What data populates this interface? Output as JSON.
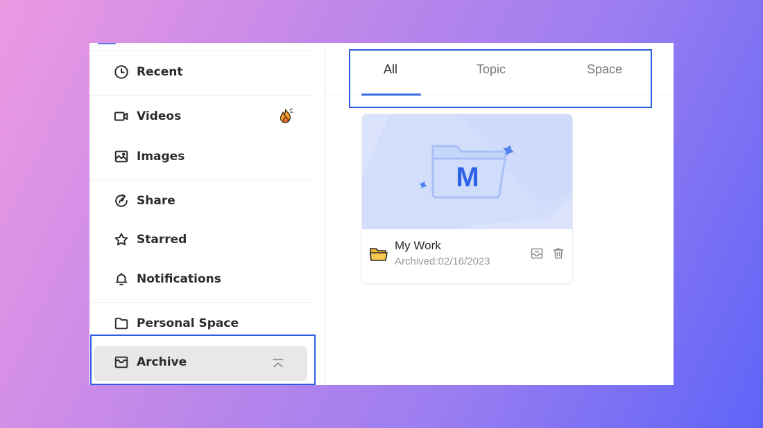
{
  "sidebar": {
    "items": [
      {
        "label": "Recent",
        "icon": "clock-icon"
      },
      {
        "label": "Videos",
        "icon": "video-icon"
      },
      {
        "label": "Images",
        "icon": "image-icon"
      },
      {
        "label": "Share",
        "icon": "share-icon"
      },
      {
        "label": "Starred",
        "icon": "star-icon"
      },
      {
        "label": "Notifications",
        "icon": "bell-icon"
      },
      {
        "label": "Personal Space",
        "icon": "folder-icon"
      },
      {
        "label": "Archive",
        "icon": "archive-icon"
      }
    ],
    "active_item": "Archive"
  },
  "tabs": [
    {
      "label": "All",
      "active": true
    },
    {
      "label": "Topic",
      "active": false
    },
    {
      "label": "Space",
      "active": false
    }
  ],
  "cards": [
    {
      "name": "My Work",
      "date": "Archived:02/16/2023",
      "thumbnail_letter": "M"
    }
  ],
  "colors": {
    "accent": "#3b6ee8",
    "highlight_border": "#2f5fe0",
    "active_bg": "#e8e8e8",
    "thumb_bg": "#dbe4fc"
  }
}
